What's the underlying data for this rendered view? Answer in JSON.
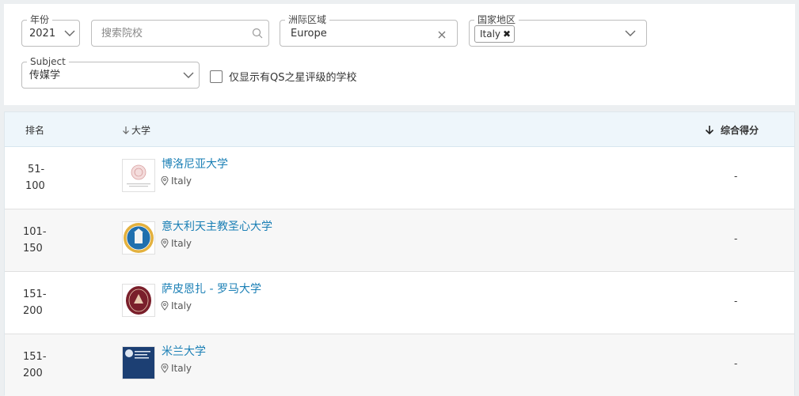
{
  "filters": {
    "year": {
      "label": "年份",
      "value": "2021"
    },
    "search": {
      "placeholder": "搜索院校"
    },
    "region": {
      "label": "洲际区域",
      "value": "Europe"
    },
    "country": {
      "label": "国家地区",
      "chip": "Italy"
    },
    "subject": {
      "label": "Subject",
      "value": "传媒学"
    },
    "qs_stars_label": "仅显示有QS之星评级的学校"
  },
  "table": {
    "header_rank": "排名",
    "header_university": "大学",
    "header_score": "综合得分",
    "rows": [
      {
        "rank_top": "51-",
        "rank_bottom": "100",
        "name": "博洛尼亚大学",
        "location": "Italy",
        "score": "-"
      },
      {
        "rank_top": "101-",
        "rank_bottom": "150",
        "name": "意大利天主教圣心大学",
        "location": "Italy",
        "score": "-"
      },
      {
        "rank_top": "151-",
        "rank_bottom": "200",
        "name": "萨皮恩扎 - 罗马大学",
        "location": "Italy",
        "score": "-"
      },
      {
        "rank_top": "151-",
        "rank_bottom": "200",
        "name": "米兰大学",
        "location": "Italy",
        "score": "-"
      }
    ]
  },
  "colors": {
    "link": "#1a7fb5",
    "header_bg": "#eef6fb",
    "alt_row": "#f7f7f7"
  }
}
